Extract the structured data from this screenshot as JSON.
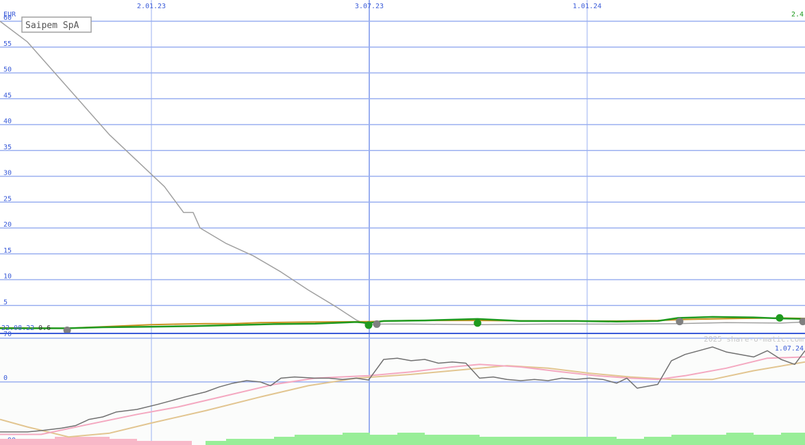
{
  "chart_data": {
    "type": "line",
    "title": "Saipem SpA",
    "currency": "EUR",
    "watermark": "2025 share-o-matic.com",
    "start_date_label": "22.08.22",
    "start_value_label": "0.6",
    "end_value_label": "2.4",
    "x_tick_labels_top": [
      "2.01.23",
      "3.07.23",
      "1.01.24"
    ],
    "x_tick_label_bottom": "1.07.24",
    "price_panel": {
      "ylim": [
        0,
        60
      ],
      "y_ticks": [
        5,
        10,
        15,
        20,
        25,
        30,
        35,
        40,
        45,
        50,
        55,
        60
      ],
      "colors": {
        "grey_line": "#a0a0a0",
        "price": "#1f9a1f",
        "avg": "#c89020",
        "marker_green": "#1f9a1f",
        "marker_grey": "#808080"
      },
      "grey_line": [
        [
          0,
          60
        ],
        [
          40,
          56
        ],
        [
          80,
          50
        ],
        [
          120,
          44
        ],
        [
          160,
          38
        ],
        [
          200,
          33
        ],
        [
          240,
          28
        ],
        [
          268,
          23
        ],
        [
          282,
          23
        ],
        [
          292,
          20
        ],
        [
          330,
          17
        ],
        [
          370,
          14.6
        ],
        [
          410,
          11.5
        ],
        [
          450,
          8
        ],
        [
          490,
          4.8
        ],
        [
          520,
          2.2
        ],
        [
          538,
          1.2
        ],
        [
          550,
          1.4
        ],
        [
          600,
          1.4
        ],
        [
          700,
          1.3
        ],
        [
          800,
          1.4
        ],
        [
          900,
          1.4
        ],
        [
          990,
          1.5
        ],
        [
          1060,
          1.7
        ],
        [
          1140,
          1.6
        ],
        [
          1175,
          1.8
        ]
      ],
      "price": [
        [
          0,
          0.6
        ],
        [
          60,
          0.6
        ],
        [
          98,
          0.6
        ],
        [
          150,
          0.8
        ],
        [
          220,
          0.9
        ],
        [
          280,
          1.0
        ],
        [
          340,
          1.2
        ],
        [
          400,
          1.4
        ],
        [
          460,
          1.5
        ],
        [
          520,
          1.8
        ],
        [
          538,
          1.6
        ],
        [
          560,
          2.0
        ],
        [
          620,
          2.1
        ],
        [
          697,
          2.4
        ],
        [
          760,
          2.0
        ],
        [
          840,
          2.0
        ],
        [
          900,
          1.9
        ],
        [
          960,
          2.0
        ],
        [
          990,
          2.6
        ],
        [
          1040,
          2.8
        ],
        [
          1100,
          2.7
        ],
        [
          1138,
          2.5
        ],
        [
          1175,
          2.4
        ]
      ],
      "avg": [
        [
          0,
          0.7
        ],
        [
          98,
          0.6
        ],
        [
          150,
          0.9
        ],
        [
          220,
          1.3
        ],
        [
          300,
          1.5
        ],
        [
          340,
          1.5
        ],
        [
          380,
          1.7
        ],
        [
          450,
          1.8
        ],
        [
          540,
          1.9
        ],
        [
          600,
          2.1
        ],
        [
          700,
          2.1
        ],
        [
          800,
          2.0
        ],
        [
          900,
          2.0
        ],
        [
          960,
          2.1
        ],
        [
          1000,
          2.3
        ],
        [
          1080,
          2.5
        ],
        [
          1138,
          2.6
        ],
        [
          1175,
          2.5
        ]
      ],
      "markers_green": [
        [
          538,
          1.2
        ],
        [
          697,
          1.6
        ],
        [
          1138,
          2.6
        ]
      ],
      "markers_grey": [
        [
          98,
          0.2
        ],
        [
          550,
          1.4
        ],
        [
          992,
          1.9
        ],
        [
          1172,
          1.9
        ]
      ]
    },
    "indicator_panel": {
      "y_ticks": [
        70,
        0,
        -90
      ],
      "ylim": [
        -90,
        70
      ],
      "colors": {
        "osc": "#707070",
        "pink": "#f4a8c0",
        "tan": "#e2c590",
        "volume": "#98ee98",
        "volume_neg": "#f8b8c8"
      },
      "osc": [
        [
          0,
          -80
        ],
        [
          40,
          -80
        ],
        [
          60,
          -78
        ],
        [
          90,
          -74
        ],
        [
          110,
          -70
        ],
        [
          130,
          -60
        ],
        [
          150,
          -56
        ],
        [
          170,
          -48
        ],
        [
          200,
          -44
        ],
        [
          230,
          -36
        ],
        [
          250,
          -30
        ],
        [
          270,
          -24
        ],
        [
          300,
          -16
        ],
        [
          320,
          -8
        ],
        [
          340,
          -2
        ],
        [
          360,
          2
        ],
        [
          380,
          0
        ],
        [
          395,
          -6
        ],
        [
          410,
          6
        ],
        [
          430,
          8
        ],
        [
          460,
          6
        ],
        [
          480,
          6
        ],
        [
          500,
          4
        ],
        [
          520,
          6
        ],
        [
          538,
          3
        ],
        [
          560,
          36
        ],
        [
          580,
          38
        ],
        [
          600,
          34
        ],
        [
          620,
          36
        ],
        [
          640,
          30
        ],
        [
          660,
          32
        ],
        [
          680,
          30
        ],
        [
          700,
          6
        ],
        [
          720,
          8
        ],
        [
          740,
          4
        ],
        [
          760,
          2
        ],
        [
          780,
          4
        ],
        [
          800,
          2
        ],
        [
          820,
          6
        ],
        [
          840,
          4
        ],
        [
          860,
          6
        ],
        [
          880,
          4
        ],
        [
          900,
          -2
        ],
        [
          915,
          6
        ],
        [
          930,
          -10
        ],
        [
          960,
          -4
        ],
        [
          980,
          34
        ],
        [
          1000,
          44
        ],
        [
          1020,
          50
        ],
        [
          1040,
          56
        ],
        [
          1060,
          48
        ],
        [
          1080,
          44
        ],
        [
          1100,
          40
        ],
        [
          1120,
          50
        ],
        [
          1140,
          36
        ],
        [
          1160,
          28
        ],
        [
          1175,
          50
        ]
      ],
      "pink": [
        [
          0,
          -84
        ],
        [
          60,
          -84
        ],
        [
          120,
          -70
        ],
        [
          200,
          -52
        ],
        [
          260,
          -40
        ],
        [
          330,
          -22
        ],
        [
          400,
          -4
        ],
        [
          460,
          6
        ],
        [
          538,
          10
        ],
        [
          600,
          16
        ],
        [
          660,
          24
        ],
        [
          700,
          28
        ],
        [
          760,
          24
        ],
        [
          820,
          16
        ],
        [
          870,
          10
        ],
        [
          920,
          6
        ],
        [
          960,
          4
        ],
        [
          1000,
          10
        ],
        [
          1060,
          22
        ],
        [
          1120,
          38
        ],
        [
          1175,
          40
        ]
      ],
      "tan": [
        [
          0,
          -60
        ],
        [
          40,
          -72
        ],
        [
          100,
          -88
        ],
        [
          160,
          -82
        ],
        [
          220,
          -66
        ],
        [
          300,
          -46
        ],
        [
          380,
          -24
        ],
        [
          450,
          -6
        ],
        [
          520,
          6
        ],
        [
          600,
          12
        ],
        [
          680,
          20
        ],
        [
          740,
          26
        ],
        [
          800,
          22
        ],
        [
          860,
          14
        ],
        [
          920,
          8
        ],
        [
          980,
          4
        ],
        [
          1040,
          4
        ],
        [
          1100,
          18
        ],
        [
          1175,
          32
        ]
      ],
      "volume_up": [
        [
          300,
          2
        ],
        [
          330,
          3
        ],
        [
          360,
          3
        ],
        [
          400,
          4
        ],
        [
          430,
          5
        ],
        [
          460,
          5
        ],
        [
          500,
          6
        ],
        [
          540,
          5
        ],
        [
          580,
          6
        ],
        [
          620,
          5
        ],
        [
          660,
          5
        ],
        [
          700,
          4
        ],
        [
          740,
          4
        ],
        [
          780,
          4
        ],
        [
          820,
          4
        ],
        [
          860,
          4
        ],
        [
          900,
          3
        ],
        [
          940,
          4
        ],
        [
          980,
          5
        ],
        [
          1020,
          5
        ],
        [
          1060,
          6
        ],
        [
          1100,
          5
        ],
        [
          1140,
          6
        ],
        [
          1175,
          5
        ]
      ],
      "volume_down": [
        [
          0,
          3
        ],
        [
          40,
          3
        ],
        [
          80,
          4
        ],
        [
          120,
          4
        ],
        [
          160,
          3
        ],
        [
          200,
          2
        ],
        [
          240,
          2
        ]
      ]
    }
  }
}
